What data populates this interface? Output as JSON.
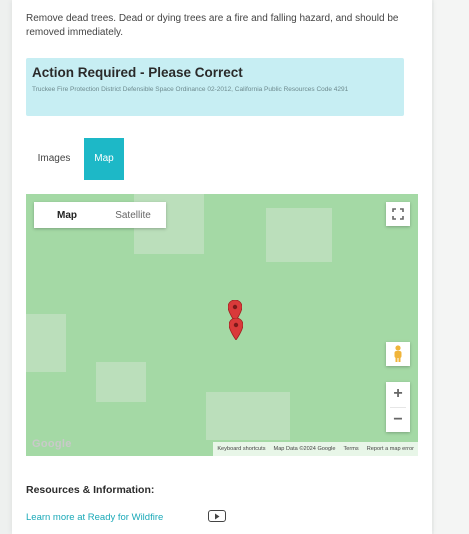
{
  "description": "Remove dead trees. Dead or dying trees are a fire and falling hazard, and should be removed immediately.",
  "alert": {
    "title": "Action Required - Please Correct",
    "subtitle": "Truckee Fire Protection District Defensible Space Ordinance 02-2012, California Public Resources Code 4291"
  },
  "tabs": [
    {
      "label": "Images",
      "active": false
    },
    {
      "label": "Map",
      "active": true
    }
  ],
  "map": {
    "type_options": [
      "Map",
      "Satellite"
    ],
    "selected_type": "Map",
    "logo_text": "Google",
    "attribution": [
      "Keyboard shortcuts",
      "Map Data ©2024 Google",
      "Terms",
      "Report a map error"
    ],
    "zoom_in": "+",
    "zoom_out": "−",
    "icons": [
      "fullscreen-icon",
      "pegman-icon",
      "map-pin-icon"
    ]
  },
  "resources": {
    "title": "Resources & Information:",
    "link": "Learn more at Ready for Wildfire"
  },
  "colors": {
    "accent": "#1db8c7",
    "alert_bg": "#c7eef3",
    "map_bg": "#a4d9a5",
    "pin": "#d93a3a",
    "pegman": "#f0b43a"
  }
}
